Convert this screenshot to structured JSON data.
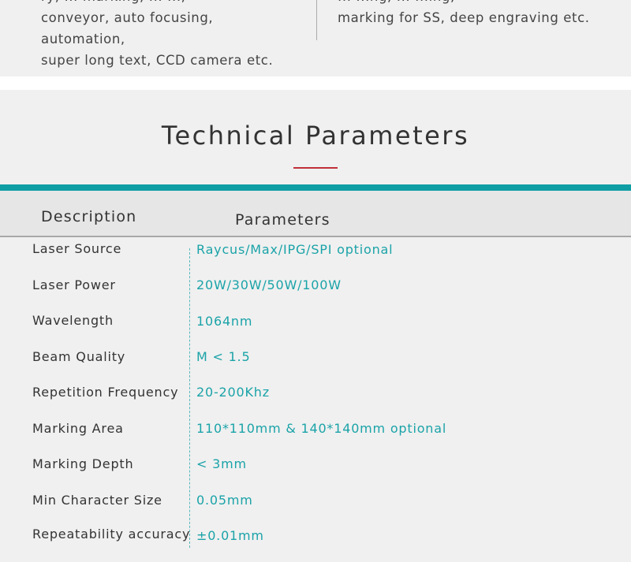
{
  "top_section": {
    "left_text": "rotary, ... marking, ... ...,  conveyor, auto focusing, automation, super long text, CCD camera etc.",
    "left_lines": [
      "ry, ... marking, ... ...,",
      "conveyor, auto focusing, automation,",
      "super long text, CCD camera etc."
    ],
    "right_lines": [
      "... ...ng, ... ...ing,",
      "marking for SS, deep engraving etc."
    ]
  },
  "section": {
    "title": "Technical Parameters"
  },
  "table": {
    "header": {
      "description": "Description",
      "parameters": "Parameters"
    },
    "rows": [
      {
        "label": "Laser Source",
        "value": "Raycus/Max/IPG/SPI optional"
      },
      {
        "label": "Laser Power",
        "value": "20W/30W/50W/100W"
      },
      {
        "label": "Wavelength",
        "value": "1064nm"
      },
      {
        "label": "Beam Quality",
        "value": "M < 1.5"
      },
      {
        "label": "Repetition Frequency",
        "value": "20-200Khz"
      },
      {
        "label": "Marking Area",
        "value": "110*110mm & 140*140mm optional"
      },
      {
        "label": "Marking Depth",
        "value": " < 3mm"
      },
      {
        "label": "Min Character Size",
        "value": "0.05mm"
      },
      {
        "label": "Repeatability accuracy",
        "value": "±0.01mm"
      }
    ]
  },
  "colors": {
    "accent_teal": "#0f9ea3",
    "value_text": "#1aa3a8",
    "underline_red": "#c0303a"
  }
}
